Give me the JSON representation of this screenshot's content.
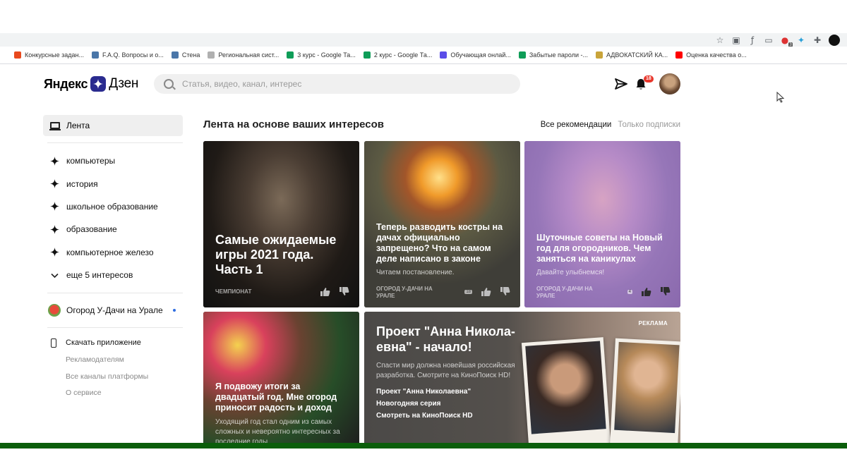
{
  "browser": {
    "bookmarks": [
      {
        "label": "Конкурсные задан...",
        "color": "#e8491d"
      },
      {
        "label": "F.A.Q. Вопросы и о...",
        "color": "#4a76a8"
      },
      {
        "label": "Стена",
        "color": "#4a76a8"
      },
      {
        "label": "Региональная сист...",
        "color": "#b0b0b0"
      },
      {
        "label": "3 курс - Google Та...",
        "color": "#0f9d58"
      },
      {
        "label": "2 курс - Google Та...",
        "color": "#0f9d58"
      },
      {
        "label": "Обучающая онлай...",
        "color": "#5b4de8"
      },
      {
        "label": "Забытые пароли -...",
        "color": "#0f9d58"
      },
      {
        "label": "АДВОКАТСКИЙ КА...",
        "color": "#c9a43a"
      },
      {
        "label": "Оценка качества о...",
        "color": "#ff0000"
      }
    ],
    "toolbar_badge": "3"
  },
  "header": {
    "logo_yandex": "Яндекс",
    "logo_dzen": "Дзен",
    "search_placeholder": "Статья, видео, канал, интерес",
    "notifications_count": "18"
  },
  "sidebar": {
    "feed_label": "Лента",
    "interests": [
      "компьютеры",
      "история",
      "школьное образование",
      "образование",
      "компьютерное железо"
    ],
    "more_interests": "еще 5 интересов",
    "channel": "Огород У-Дачи на Урале",
    "app_label": "Скачать приложение",
    "links": [
      "Рекламодателям",
      "Все каналы платформы",
      "О сервисе"
    ]
  },
  "feed": {
    "title": "Лента на основе ваших интересов",
    "tab_all": "Все рекомендации",
    "tab_subs": "Только подписки"
  },
  "cards": [
    {
      "title": "Самые ожидаемые игры 2021 года. Часть 1",
      "subtitle": "",
      "source": "ЧЕМПИОНАТ",
      "comments": ""
    },
    {
      "title": "Теперь разводить костры на дачах официально запрещено? Что на самом деле написано в законе",
      "subtitle": "Читаем постановление.",
      "source": "ОГОРОД У-ДАЧИ НА УРАЛЕ",
      "comments": "18"
    },
    {
      "title": "Шуточные советы на Новый год для огородников. Чем заняться на каникулах",
      "subtitle": "Давайте улыбнемся!",
      "source": "ОГОРОД У-ДАЧИ НА УРАЛЕ",
      "comments": "4"
    },
    {
      "title": "Я подвожу итоги за двадцатый год. Мне огород приносит радость и доход",
      "subtitle": "Уходящий год стал одним из самых сложных и невероятно интересных за последние годы",
      "source": "",
      "comments": ""
    }
  ],
  "ad": {
    "label": "РЕКЛАМА",
    "title": "Проект \"Анна Никола-евна\" - начало!",
    "subtitle": "Спасти мир должна новейшая российская разработка. Смотрите на КиноПоиск HD!",
    "links": [
      "Проект \"Анна Николаевна\"",
      "Новогодняя серия",
      "Смотреть на КиноПоиск HD"
    ]
  },
  "colors": {
    "bottom_bar": "#0b5e0b",
    "badge_red": "#e8362b",
    "logo_star": "#2a2b8f"
  }
}
